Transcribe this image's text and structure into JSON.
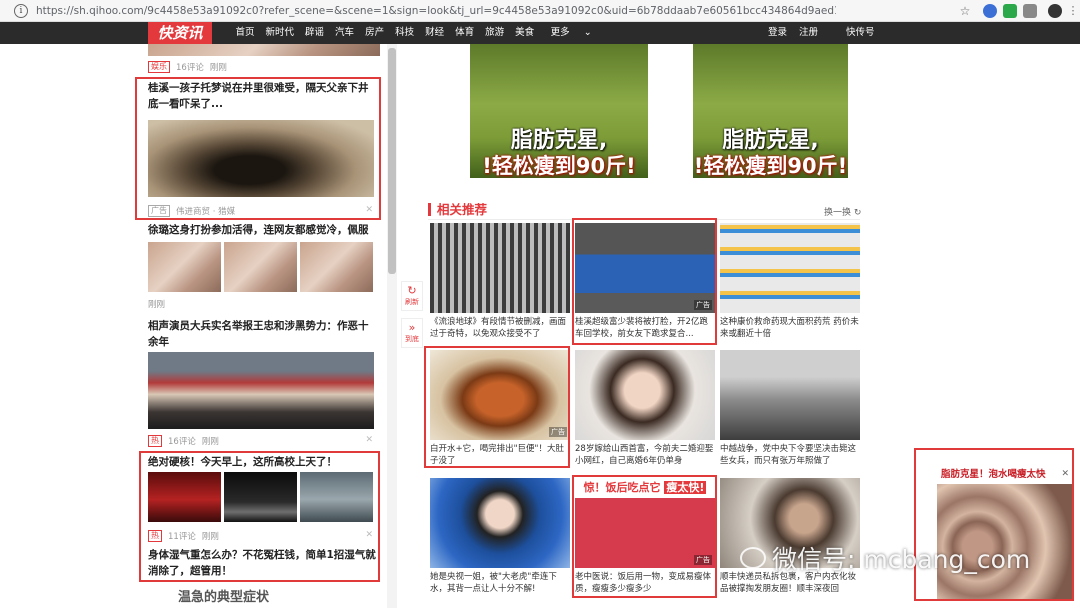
{
  "browser": {
    "url": "https://sh.qihoo.com/9c4458e53a91092c0?refer_scene=&scene=1&sign=look&tj_url=9c4458e53a91092c0&uid=6b78ddaab7e60561bcc434864d9aed1e"
  },
  "nav": {
    "logo": "快资讯",
    "items": [
      "首页",
      "新时代",
      "辟谣",
      "汽车",
      "房产",
      "科技",
      "财经",
      "体育",
      "旅游",
      "美食",
      "更多"
    ],
    "login": "登录",
    "register": "注册",
    "quick": "快传号"
  },
  "feed": {
    "top_meta": {
      "tag": "娱乐",
      "comments": "16评论",
      "time": "刚刚"
    },
    "well_article": {
      "title": "桂溪一孩子托梦说在井里很难受，隔天父亲下井底一看吓呆了...",
      "tag": "广告",
      "source": "伟进商贸 · 猎媒"
    },
    "bath_article": {
      "title": "徐璐这身打扮参加活得，连网友都感觉冷，佩服",
      "time": "刚刚"
    },
    "crowd_article": {
      "title": "相声演员大兵实名举报王忠和涉黑势力：作恶十余年",
      "tag": "热",
      "comments": "16评论",
      "time": "刚刚"
    },
    "school_article": {
      "title": "绝对硬核！今天早上，这所高校上天了！"
    },
    "health_meta": {
      "tag": "热",
      "comments": "11评论",
      "time": "刚刚"
    },
    "health_article": {
      "title": "身体湿气重怎么办？不花冤枉钱，简单1招湿气就消除了，超管用！"
    },
    "next_title": "温急的典型症状"
  },
  "banner": {
    "line1": "脂肪克星,",
    "line2": "!轻松瘦到90斤!"
  },
  "related": {
    "title": "相关推荐",
    "refresh": "换一换",
    "cards": [
      {
        "caption": "《流浪地球》有段情节被删减，画面过于奇特，以免观众接受不了"
      },
      {
        "caption": "桂溪超级富少裴将被打脸，开2亿跑车回学校，前女友下跪求复合...",
        "ad": "广告"
      },
      {
        "caption": "这种康价救命药现大面积药荒 药价未来或翻近十倍"
      },
      {
        "caption": "白开水+它，喝完排出\"巨便\"！大肚子没了",
        "ad": "广告"
      },
      {
        "caption": "28岁嫁给山西首富，今前夫二婚迎娶小网红，自己离婚6年仍单身"
      },
      {
        "caption": "中越战争，党中央下令要坚决击毙这些女兵，而只有张万年照做了"
      },
      {
        "caption": "她是央视一姐，被\"大老虎\"牵连下水，其背一点让人十分不解!"
      },
      {
        "caption": "老中医说：饭后用一物，变成易瘦体质，瘦瘦多少瘦多少",
        "ad": "广告",
        "band1": "惊！饭后吃点它",
        "band2": "瘦太快!"
      },
      {
        "caption": "顺丰快递员私拆包裹，客户内衣化妆品被撑掏发朋友圈！顺丰深夜回"
      }
    ]
  },
  "side": {
    "refresh": "刷新",
    "bottom": "到底"
  },
  "float_ad": {
    "headline": "脂肪克星！泡水喝瘦太快"
  },
  "watermark": "微信号: mcbang_com"
}
